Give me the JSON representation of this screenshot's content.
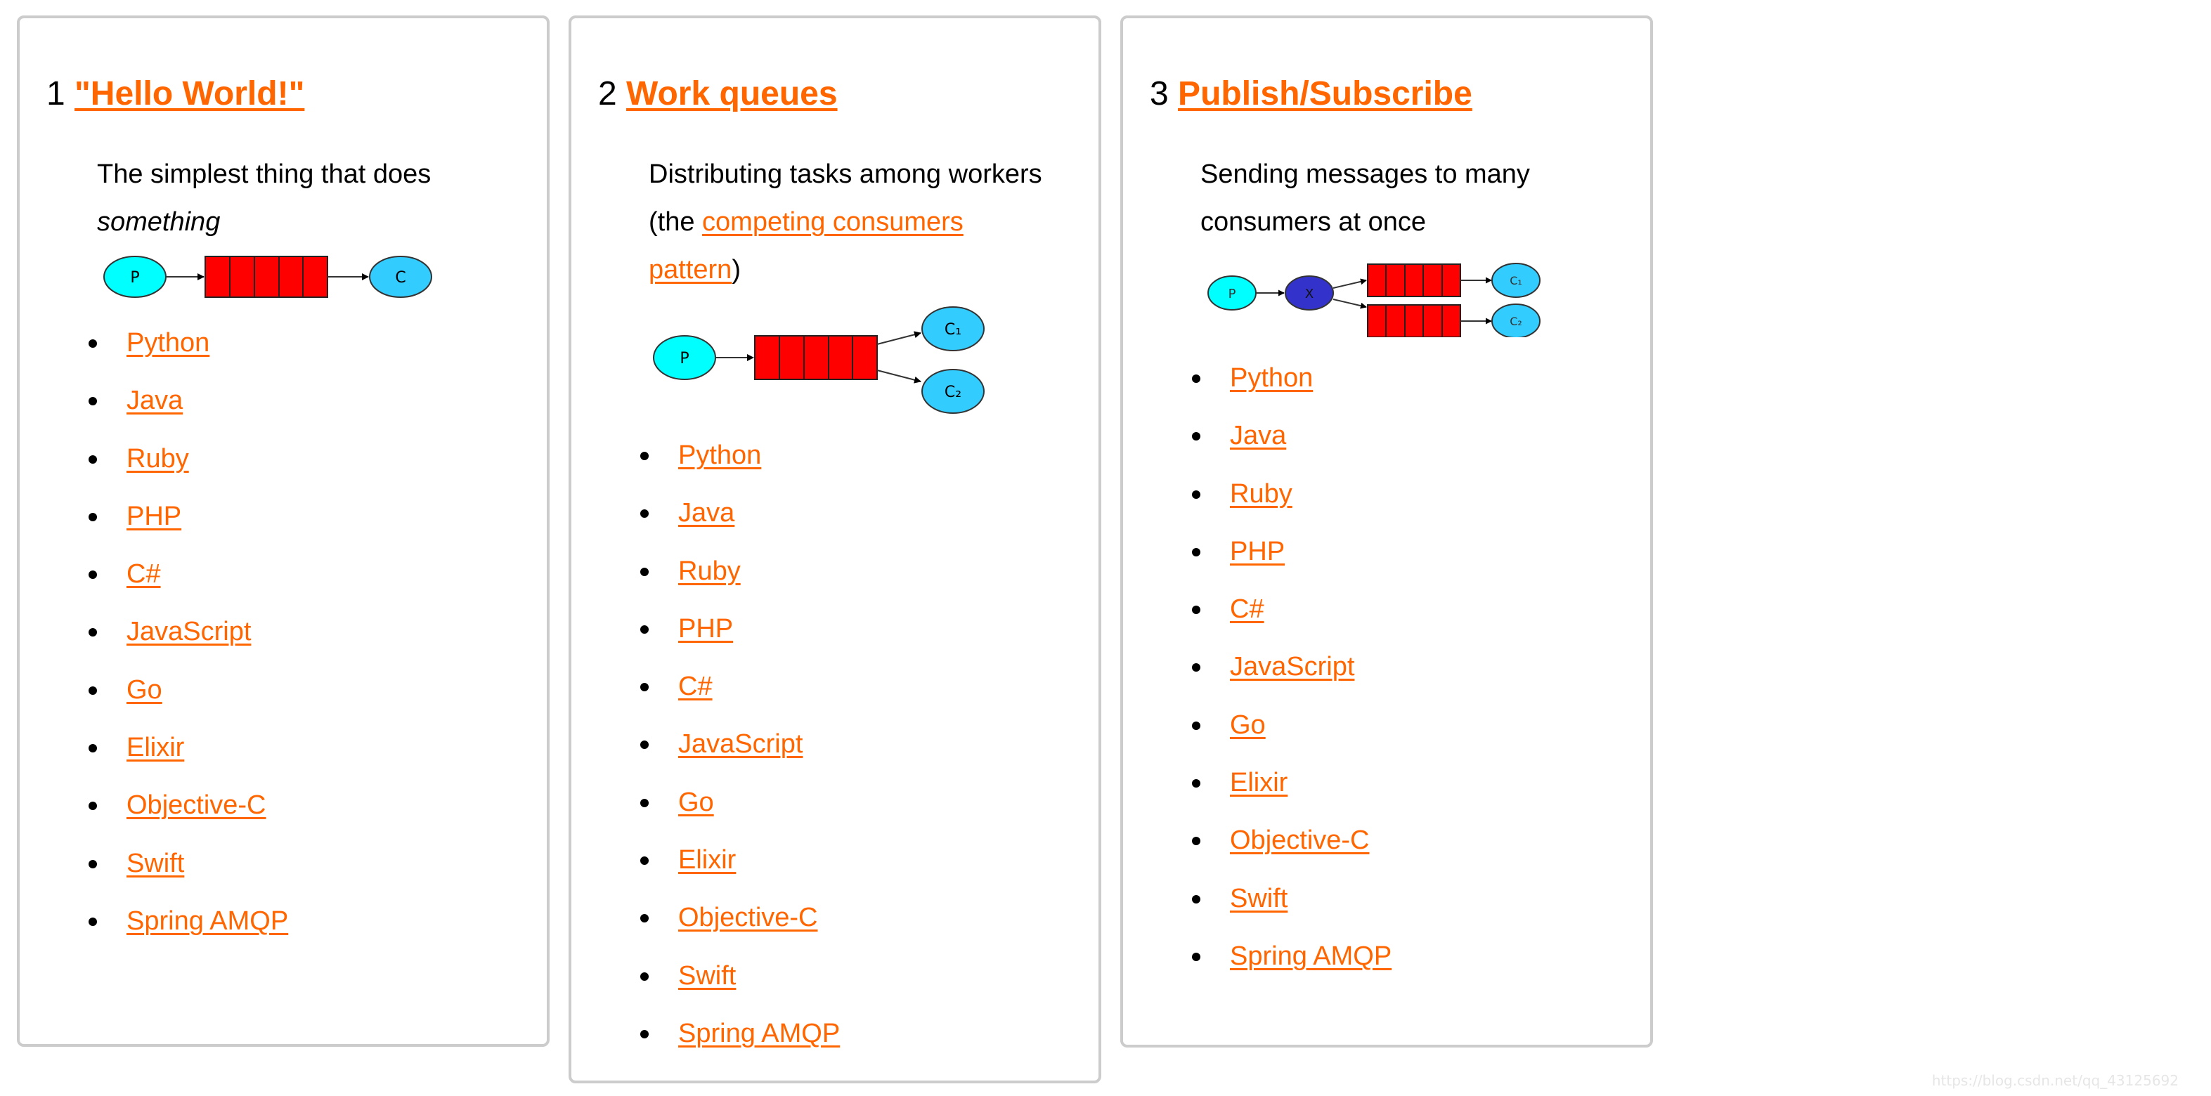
{
  "colors": {
    "link": "#ff6600",
    "card_border": "#cccccc",
    "producer": "#00ffff",
    "consumer": "#33ccff",
    "queue": "#ff0000",
    "exchange": "#3333cc"
  },
  "cards": [
    {
      "number": "1",
      "title": "\"Hello World!\"",
      "description": {
        "text": "The simplest thing that does ",
        "emphasis": "something"
      },
      "diagram": {
        "type": "simple",
        "producer_label": "P",
        "consumer_labels": [
          "C"
        ],
        "icon": "producer-queue-consumer-diagram"
      },
      "languages": [
        "Python",
        "Java",
        "Ruby",
        "PHP",
        "C#",
        "JavaScript",
        "Go",
        "Elixir",
        "Objective-C",
        "Swift",
        "Spring AMQP"
      ]
    },
    {
      "number": "2",
      "title": "Work queues",
      "description": {
        "text": "Distributing tasks among workers (the ",
        "link": "competing consumers pattern",
        "suffix": ")"
      },
      "diagram": {
        "type": "work-queue",
        "producer_label": "P",
        "consumer_labels": [
          "C₁",
          "C₂"
        ],
        "icon": "work-queue-diagram"
      },
      "languages": [
        "Python",
        "Java",
        "Ruby",
        "PHP",
        "C#",
        "JavaScript",
        "Go",
        "Elixir",
        "Objective-C",
        "Swift",
        "Spring AMQP"
      ]
    },
    {
      "number": "3",
      "title": "Publish/Subscribe",
      "description": {
        "text": "Sending messages to many consumers at once"
      },
      "diagram": {
        "type": "pubsub",
        "producer_label": "P",
        "exchange_label": "X",
        "consumer_labels": [
          "C₁",
          "C₂"
        ],
        "icon": "publish-subscribe-diagram"
      },
      "languages": [
        "Python",
        "Java",
        "Ruby",
        "PHP",
        "C#",
        "JavaScript",
        "Go",
        "Elixir",
        "Objective-C",
        "Swift",
        "Spring AMQP"
      ]
    }
  ],
  "watermark": "https://blog.csdn.net/qq_43125692"
}
